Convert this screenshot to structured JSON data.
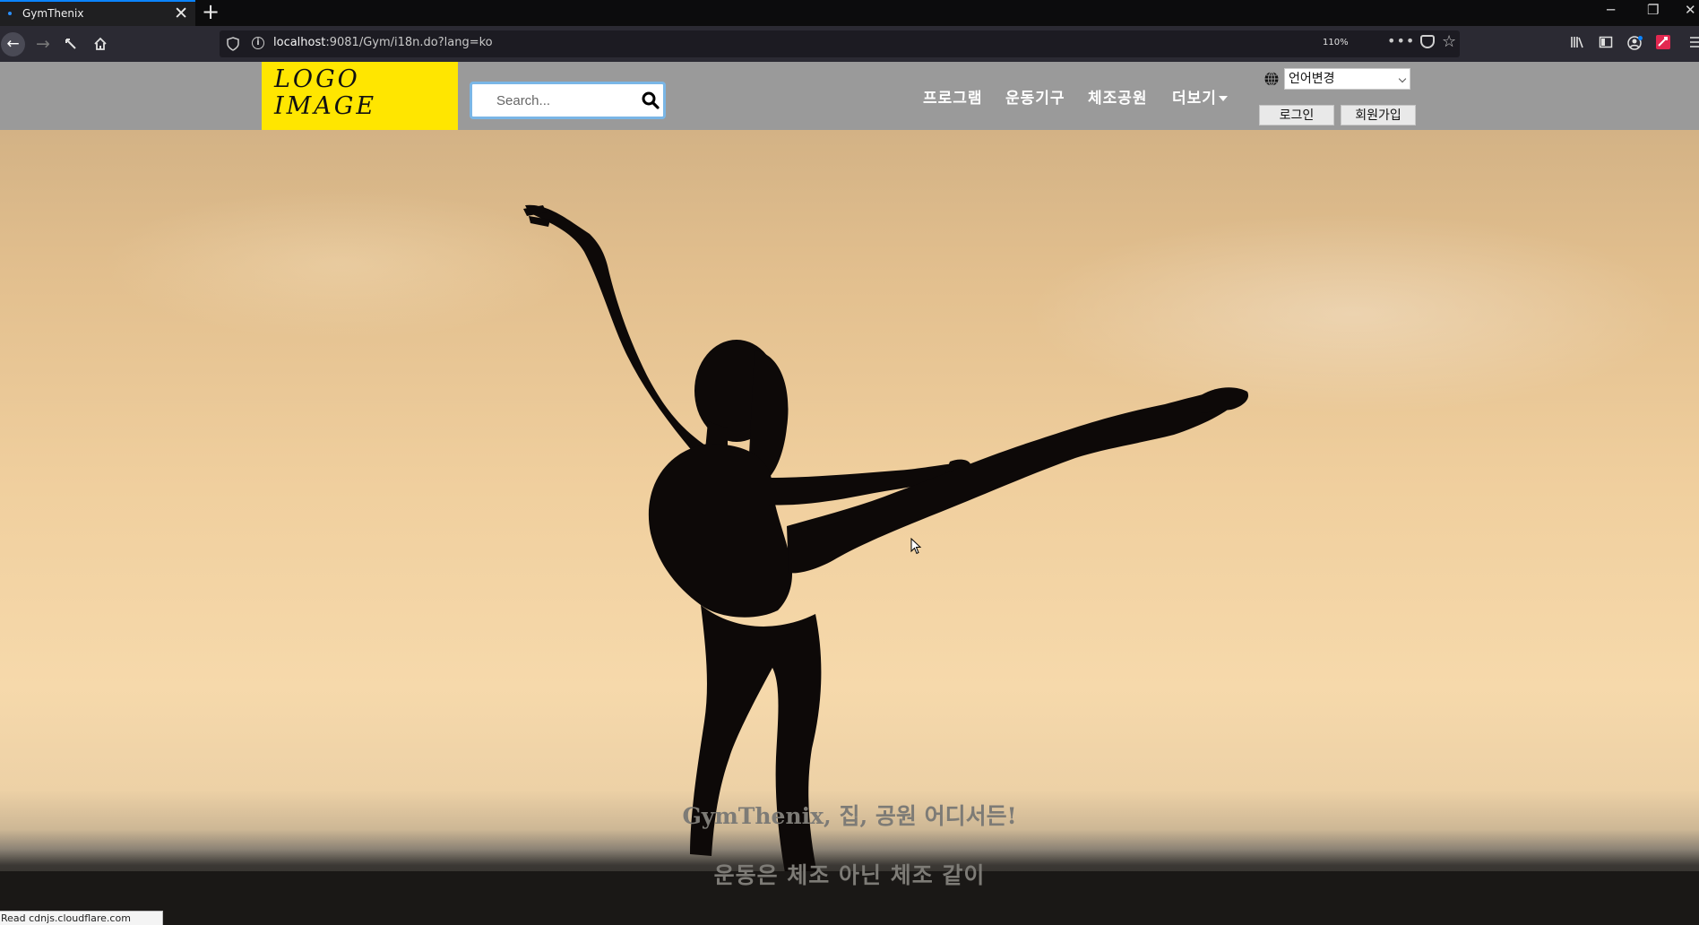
{
  "browser": {
    "tab_title": "GymThenix",
    "tab_close": "✕",
    "new_tab": "+",
    "url_host": "localhost",
    "url_rest": ":9081/Gym/i18n.do?lang=ko",
    "zoom": "110%",
    "more": "•••",
    "window_min": "─",
    "window_restore": "❐",
    "window_close": "✕",
    "status_text": "Read cdnjs.cloudflare.com"
  },
  "header": {
    "logo_line1": "LOGO",
    "logo_line2": "IMAGE",
    "search_placeholder": "Search...",
    "menu": [
      "프로그램",
      "운동기구",
      "체조공원",
      "더보기"
    ],
    "language_select": "언어변경",
    "login": "로그인",
    "signup": "회원가입"
  },
  "hero": {
    "tagline1": "GymThenix, 집, 공원 어디서든!",
    "tagline2": "운동은 체조 아닌 체조 같이"
  },
  "colors": {
    "header_bg": "#9a9a9a",
    "logo_bg": "#ffe600",
    "search_border": "#7ab6e6",
    "tagline": "#7d7b76"
  }
}
